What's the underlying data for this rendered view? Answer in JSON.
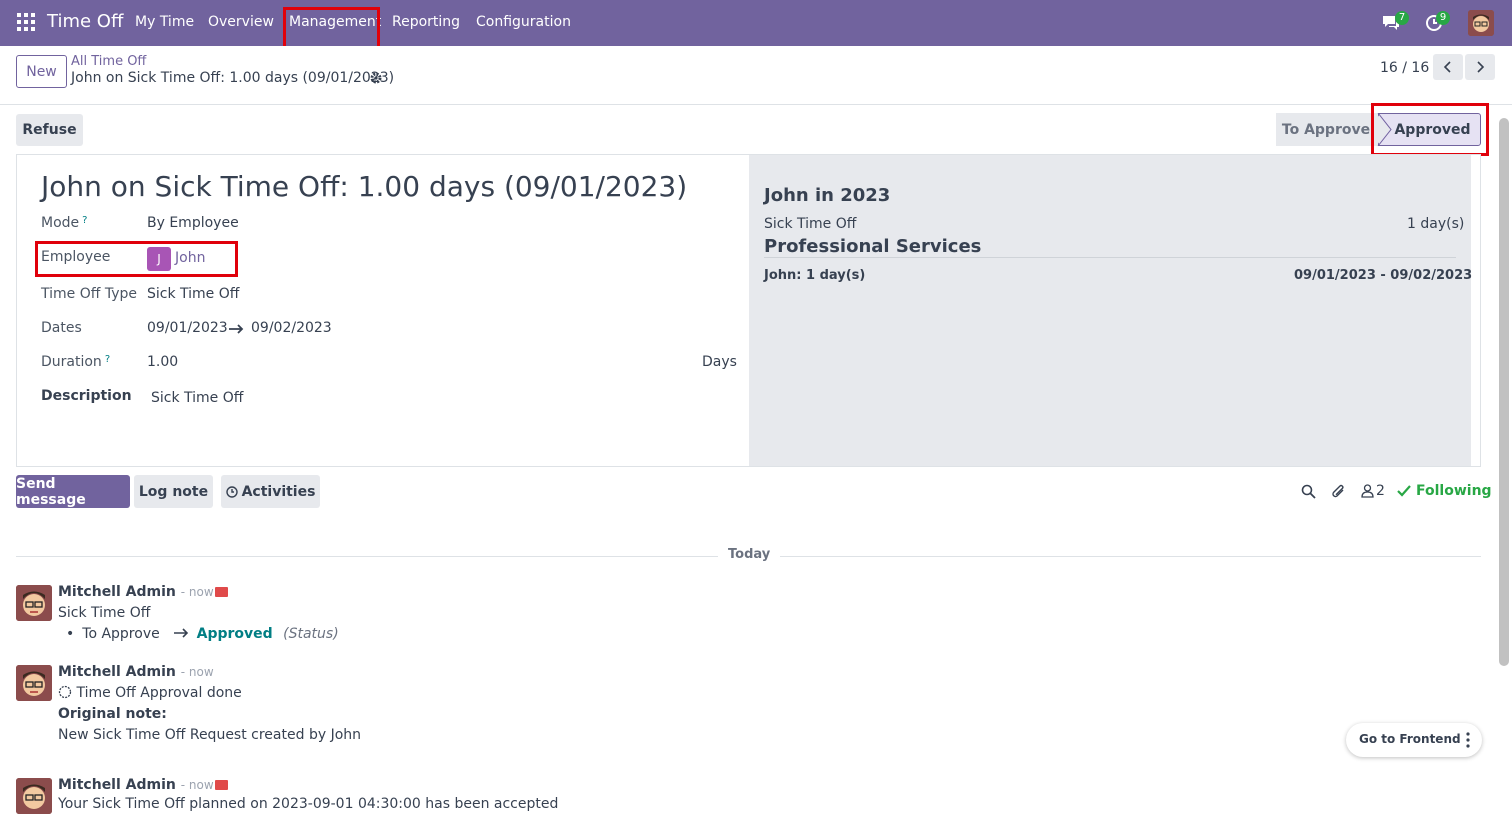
{
  "navbar": {
    "app_title": "Time Off",
    "menu": [
      "My Time",
      "Overview",
      "Management",
      "Reporting",
      "Configuration"
    ],
    "messages_count": "7",
    "activities_count": "9"
  },
  "control_panel": {
    "new_label": "New",
    "breadcrumb_parent": "All Time Off",
    "breadcrumb_current": "John on Sick Time Off: 1.00 days (09/01/2023)",
    "pager": "16 / 16"
  },
  "statusbar": {
    "refuse_label": "Refuse",
    "stages": [
      "To Approve",
      "Approved"
    ],
    "active_stage": "Approved"
  },
  "form": {
    "title": "John on Sick Time Off: 1.00 days (09/01/2023)",
    "mode_label": "Mode",
    "mode_value": "By Employee",
    "employee_label": "Employee",
    "employee_initial": "J",
    "employee_value": "John",
    "type_label": "Time Off Type",
    "type_value": "Sick Time Off",
    "dates_label": "Dates",
    "date_from": "09/01/2023",
    "date_to": "09/02/2023",
    "duration_label": "Duration",
    "duration_value": "1.00",
    "duration_unit": "Days",
    "description_label": "Description",
    "description_value": "Sick Time Off",
    "help_mark": "?"
  },
  "summary": {
    "heading": "John in 2023",
    "type_label": "Sick Time Off",
    "type_days": "1 day(s)",
    "department": "Professional Services",
    "line_label": "John: 1 day(s)",
    "line_dates": "09/01/2023 - 09/02/2023"
  },
  "chatter": {
    "send_message": "Send message",
    "log_note": "Log note",
    "activities": "Activities",
    "followers_count": "2",
    "following": "Following",
    "today": "Today",
    "messages": [
      {
        "author": "Mitchell Admin",
        "time": "- now",
        "body": "Sick Time Off",
        "tracking_old": "To Approve",
        "tracking_new": "Approved",
        "tracking_field": "(Status)"
      },
      {
        "author": "Mitchell Admin",
        "time": "- now",
        "body": "Time Off Approval done",
        "note_label": "Original note:",
        "note": "New Sick Time Off Request created by John"
      },
      {
        "author": "Mitchell Admin",
        "time": "- now",
        "body": "Your Sick Time Off planned on 2023-09-01 04:30:00 has been accepted"
      }
    ]
  },
  "frontend_label": "Go to Frontend"
}
